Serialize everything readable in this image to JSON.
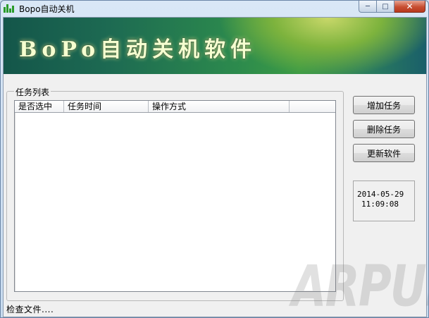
{
  "window": {
    "title": "Bopo自动关机",
    "controls": {
      "minimize": "─",
      "maximize": "□",
      "close": "✕"
    }
  },
  "banner": {
    "title": "BoPo自动关机软件"
  },
  "task_list": {
    "group_label": "任务列表",
    "columns": [
      "是否选中",
      "任务时间",
      "操作方式",
      ""
    ],
    "rows": []
  },
  "buttons": {
    "add_task": "增加任务",
    "delete_task": "删除任务",
    "update_software": "更新软件"
  },
  "clock": {
    "date": "2014-05-29",
    "time": "11:09:08"
  },
  "status": {
    "text": "检查文件...."
  },
  "watermark": {
    "text": "ARPUN"
  }
}
